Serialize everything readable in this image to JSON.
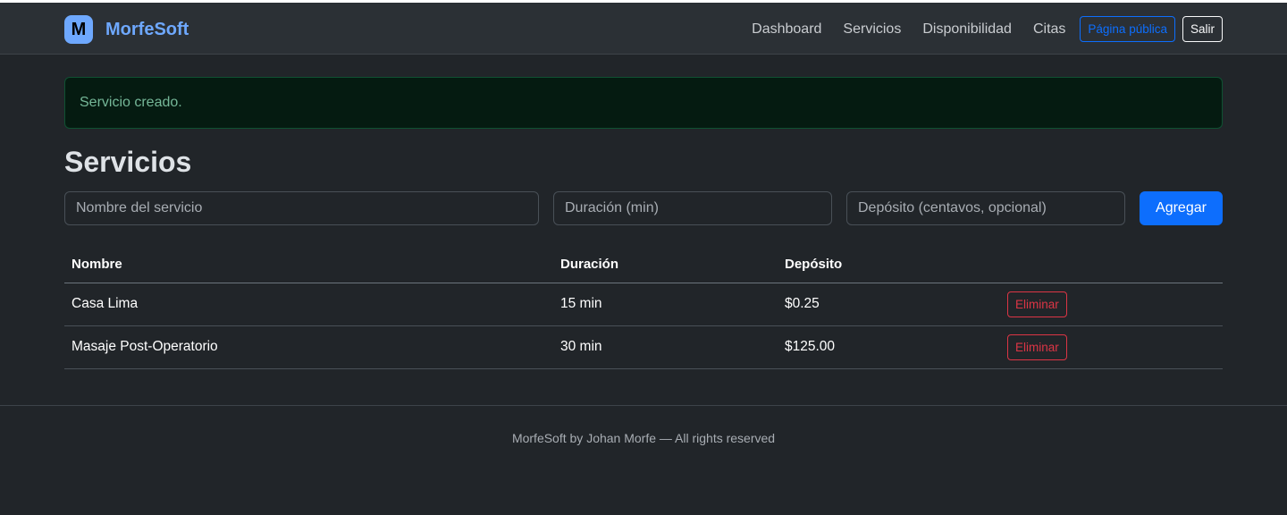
{
  "brand": {
    "logo_letter": "M",
    "name": "MorfeSoft"
  },
  "nav": {
    "dashboard": "Dashboard",
    "services": "Servicios",
    "availability": "Disponibilidad",
    "appointments": "Citas",
    "public_page": "Página pública",
    "logout": "Salir"
  },
  "alert": {
    "message": "Servicio creado."
  },
  "page": {
    "title": "Servicios"
  },
  "form": {
    "name_placeholder": "Nombre del servicio",
    "duration_placeholder": "Duración (min)",
    "deposit_placeholder": "Depósito (centavos, opcional)",
    "submit_label": "Agregar"
  },
  "table": {
    "headers": {
      "name": "Nombre",
      "duration": "Duración",
      "deposit": "Depósito"
    },
    "rows": [
      {
        "name": "Casa Lima",
        "duration": "15 min",
        "deposit": "$0.25",
        "action": "Eliminar"
      },
      {
        "name": "Masaje Post-Operatorio",
        "duration": "30 min",
        "deposit": "$125.00",
        "action": "Eliminar"
      }
    ]
  },
  "footer": {
    "text": "MorfeSoft by Johan Morfe — All rights reserved"
  },
  "colors": {
    "background": "#212529",
    "navbar": "#2b3035",
    "brand": "#6ea8fe",
    "primary": "#0d6efd",
    "success_text": "#75b798",
    "success_bg": "#051b11",
    "danger": "#dc3545"
  }
}
